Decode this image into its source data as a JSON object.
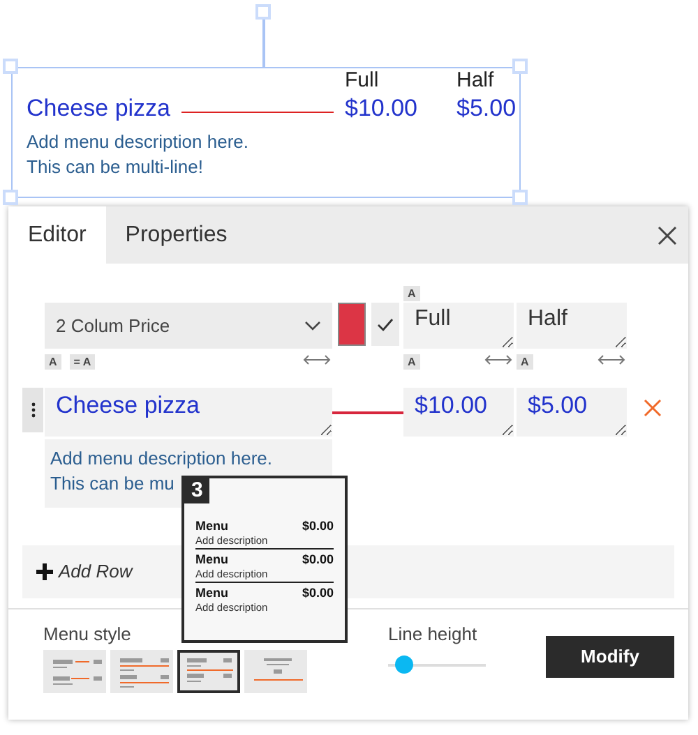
{
  "preview": {
    "headers": [
      "Full",
      "Half"
    ],
    "name": "Cheese pizza",
    "prices": [
      "$10.00",
      "$5.00"
    ],
    "description": "Add menu description here.\nThis can be multi-line!"
  },
  "tabs": [
    {
      "label": "Editor",
      "selected": true
    },
    {
      "label": "Properties",
      "selected": false
    }
  ],
  "editor": {
    "template": "2 Colum Price",
    "header_badge": "A",
    "columns": [
      "Full",
      "Half"
    ],
    "name_badges": [
      "A",
      "= A"
    ],
    "price_badges": [
      "A",
      "A"
    ],
    "name": "Cheese pizza",
    "prices": [
      "$10.00",
      "$5.00"
    ],
    "description": "Add menu description here.\nThis can be mu",
    "add_row": "Add Row"
  },
  "tooltip": {
    "number": "3",
    "items": [
      {
        "name": "Menu",
        "price": "$0.00",
        "description": "Add description"
      },
      {
        "name": "Menu",
        "price": "$0.00",
        "description": "Add description"
      },
      {
        "name": "Menu",
        "price": "$0.00",
        "description": "Add description"
      }
    ]
  },
  "menu_style": {
    "label": "Menu style",
    "styles": [
      {
        "kind": "leader",
        "selected": false
      },
      {
        "kind": "underline",
        "selected": false
      },
      {
        "kind": "divider",
        "selected": true
      },
      {
        "kind": "centered",
        "selected": false
      }
    ]
  },
  "line_height": {
    "label": "Line height",
    "level": 0.08
  },
  "modify": "Modify"
}
